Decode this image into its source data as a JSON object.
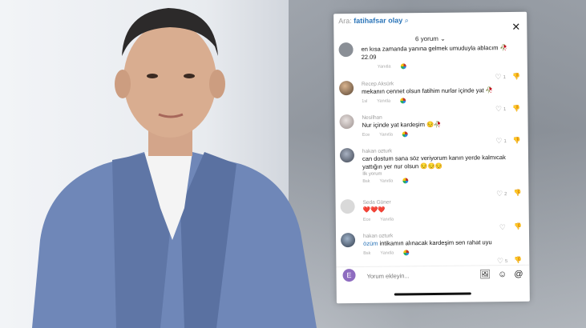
{
  "search": {
    "prefix": "Ara:",
    "query": "fatihafsar olay"
  },
  "header": {
    "comment_count": "6 yorum ⌄",
    "close_label": "✕"
  },
  "comments": [
    {
      "username": "",
      "text": "en kısa zamanda yanına gelmek umuduyla ablacım 🥀22.09",
      "reply": "Yanıtla",
      "likes": "1"
    },
    {
      "username": "Recep Aksürk",
      "text": "mekanın cennet olsun fatihim nurlar içinde yat 🥀",
      "time": "1sl",
      "reply": "Yanıtla",
      "likes": "1"
    },
    {
      "username": "Nesilhan",
      "text": "Nur içinde yat kardeşim 😔🥀",
      "time": "Ece",
      "reply": "Yanıtla",
      "likes": "1"
    },
    {
      "username": "hakan ozturk",
      "text": "can dostum sana söz veriyorum kanın yerde kalmıcak yattığın yer nur olsun 😔😔😔",
      "time": "Bsk",
      "reply": "Yanıtla",
      "likes": "2",
      "view_replies": "İlk yorum"
    },
    {
      "username": "Seda Güner",
      "text": "❤️❤️❤️",
      "time": "Ece",
      "reply": "Yanıtla",
      "likes": ""
    },
    {
      "username": "hakan ozturk",
      "mention": "özüm",
      "text": " intikamın alınacak kardeşim sen rahat uyu",
      "time": "Bsk",
      "reply": "Yanıtla",
      "likes": "5"
    }
  ],
  "composer": {
    "avatar_letter": "E",
    "placeholder": "Yorum ekleyin..."
  },
  "icons": {
    "image": "🖼",
    "emoji": "☺",
    "mention": "@"
  }
}
